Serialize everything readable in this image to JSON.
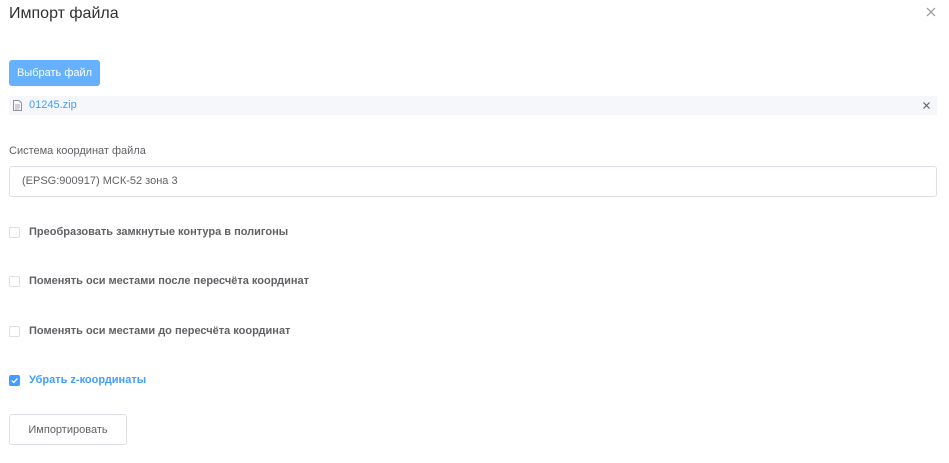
{
  "dialog": {
    "title": "Импорт файла"
  },
  "upload": {
    "choose_label": "Выбрать файл",
    "file_name": "01245.zip"
  },
  "crs": {
    "label": "Система координат файла",
    "value": "(EPSG:900917) МСК-52 зона 3"
  },
  "options": [
    {
      "label": "Преобразовать замкнутые контура в полигоны",
      "checked": false
    },
    {
      "label": "Поменять оси местами после пересчёта координат",
      "checked": false
    },
    {
      "label": "Поменять оси местами до пересчёта координат",
      "checked": false
    },
    {
      "label": "Убрать z-координаты",
      "checked": true
    }
  ],
  "actions": {
    "import_label": "Импортировать"
  },
  "colors": {
    "accent": "#409eff",
    "accent_light": "#66b1ff",
    "border": "#dcdfe6",
    "text": "#606266"
  }
}
